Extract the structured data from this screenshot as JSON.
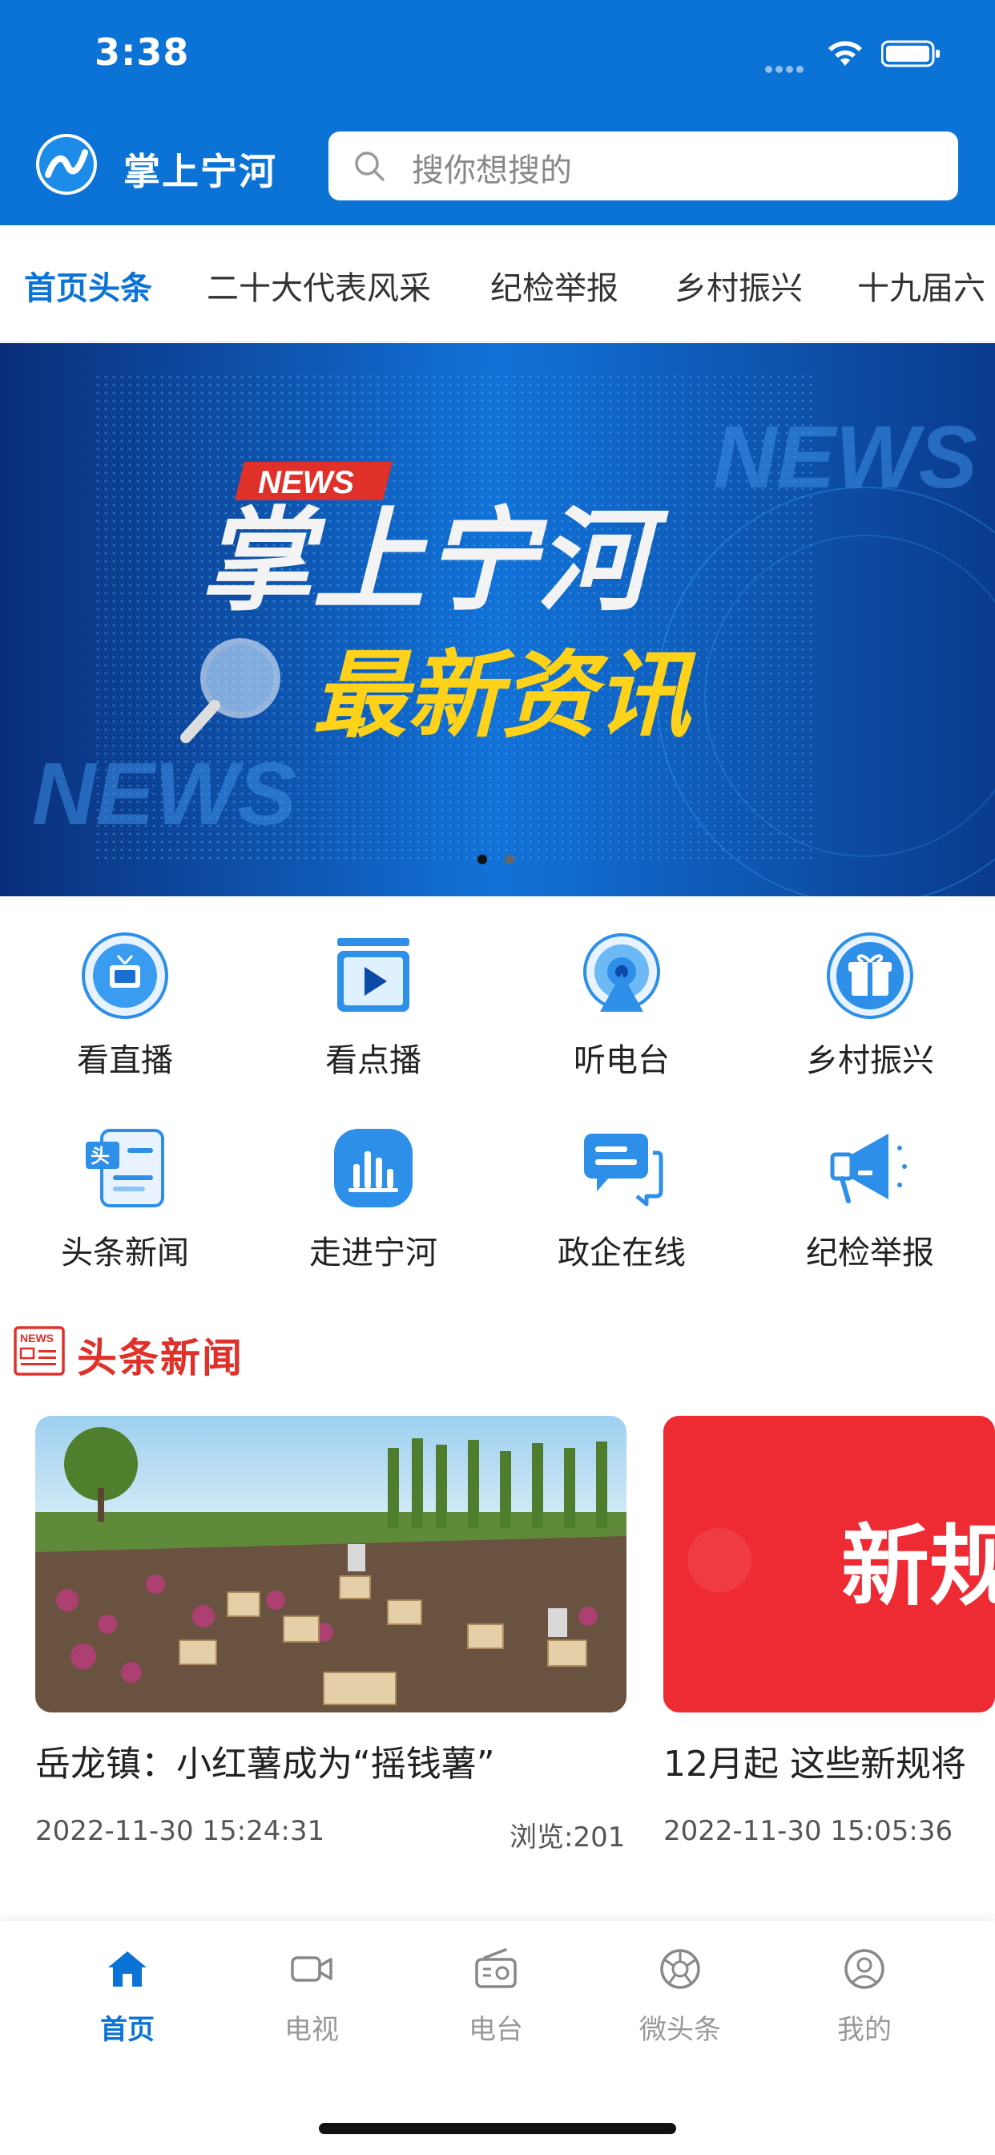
{
  "status_bar": {
    "time": "3:38"
  },
  "header": {
    "app_name": "掌上宁河",
    "search_placeholder": "搜你想搜的"
  },
  "tabs": [
    {
      "label": "首页头条",
      "active": true
    },
    {
      "label": "二十大代表风采",
      "active": false
    },
    {
      "label": "纪检举报",
      "active": false
    },
    {
      "label": "乡村振兴",
      "active": false
    },
    {
      "label": "十九届六",
      "active": false
    }
  ],
  "banner": {
    "tag": "NEWS",
    "title": "掌上宁河",
    "subtitle": "最新资讯",
    "watermark": "NEWS",
    "page_index": 1,
    "page_count": 2
  },
  "shortcuts": [
    {
      "label": "看直播",
      "icon": "tv-icon"
    },
    {
      "label": "看点播",
      "icon": "play-icon"
    },
    {
      "label": "听电台",
      "icon": "radio-icon"
    },
    {
      "label": "乡村振兴",
      "icon": "gift-icon"
    },
    {
      "label": "头条新闻",
      "icon": "headline-news-icon"
    },
    {
      "label": "走进宁河",
      "icon": "chart-icon"
    },
    {
      "label": "政企在线",
      "icon": "chat-icon"
    },
    {
      "label": "纪检举报",
      "icon": "megaphone-icon"
    }
  ],
  "section": {
    "title": "头条新闻",
    "icon_text": "NEWS"
  },
  "news_cards": [
    {
      "title": "岳龙镇：小红薯成为“摇钱薯”",
      "time": "2022-11-30 15:24:31",
      "views": "浏览:201"
    },
    {
      "title": "12月起 这些新规将",
      "time": "2022-11-30 15:05:36",
      "thumb_text": "新规"
    }
  ],
  "bottom_nav": [
    {
      "label": "首页",
      "icon": "home-icon",
      "active": true
    },
    {
      "label": "电视",
      "icon": "video-camera-icon",
      "active": false
    },
    {
      "label": "电台",
      "icon": "radio-icon",
      "active": false
    },
    {
      "label": "微头条",
      "icon": "aperture-icon",
      "active": false
    },
    {
      "label": "我的",
      "icon": "user-icon",
      "active": false
    }
  ],
  "colors": {
    "brand": "#0b72d6",
    "section_red": "#e0302a",
    "banner_yellow": "#ffd21a"
  }
}
